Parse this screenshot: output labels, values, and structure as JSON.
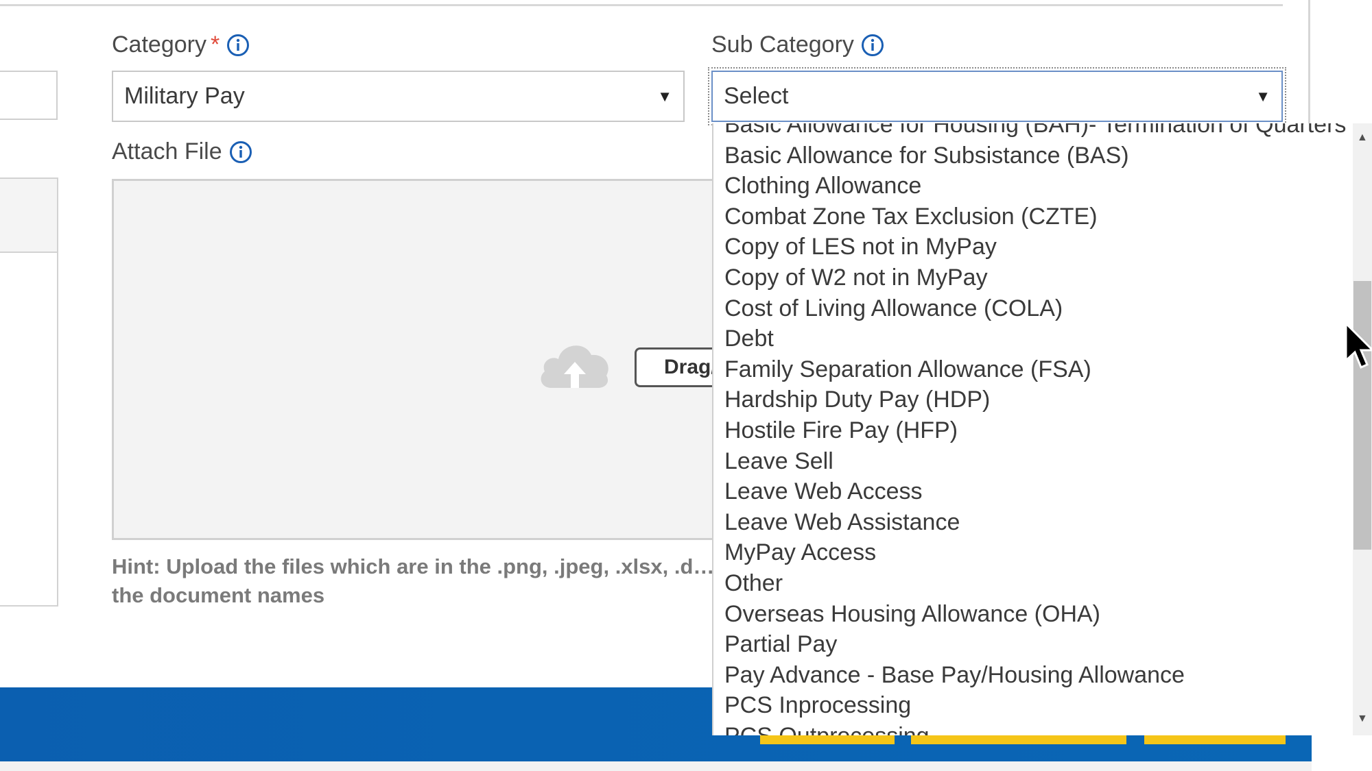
{
  "form": {
    "category": {
      "label": "Category",
      "required_mark": "*",
      "selected": "Military Pay"
    },
    "sub_category": {
      "label": "Sub Category",
      "selected": "Select",
      "options": [
        "Basic Allowance for Housing (BAH)- Termination of Quarters",
        "Basic Allowance for Subsistance (BAS)",
        "Clothing Allowance",
        "Combat Zone Tax Exclusion (CZTE)",
        "Copy of LES not in MyPay",
        "Copy of W2 not in MyPay",
        "Cost of Living Allowance (COLA)",
        "Debt",
        "Family Separation Allowance (FSA)",
        "Hardship Duty Pay (HDP)",
        "Hostile Fire Pay (HFP)",
        "Leave Sell",
        "Leave Web Access",
        "Leave Web Assistance",
        "MyPay Access",
        "Other",
        "Overseas Housing Allowance (OHA)",
        "Partial Pay",
        "Pay Advance - Base Pay/Housing Allowance",
        "PCS Inprocessing",
        "PCS Outprocessing"
      ]
    },
    "attach_file": {
      "label": "Attach File",
      "drag_button": "Drag/",
      "hint": "Hint: Upload the files which are in the .png, .jpeg, .xlsx, .d… the document names"
    }
  },
  "icons": {
    "info": "info-circle-icon",
    "dropdown": "caret-down-icon",
    "upload": "cloud-upload-icon",
    "cursor": "mouse-pointer-icon"
  },
  "colors": {
    "accent_blue": "#1a5fb4",
    "required_red": "#e04a3a",
    "footer_blue": "#0a62b2",
    "footer_gold": "#f5c518"
  }
}
